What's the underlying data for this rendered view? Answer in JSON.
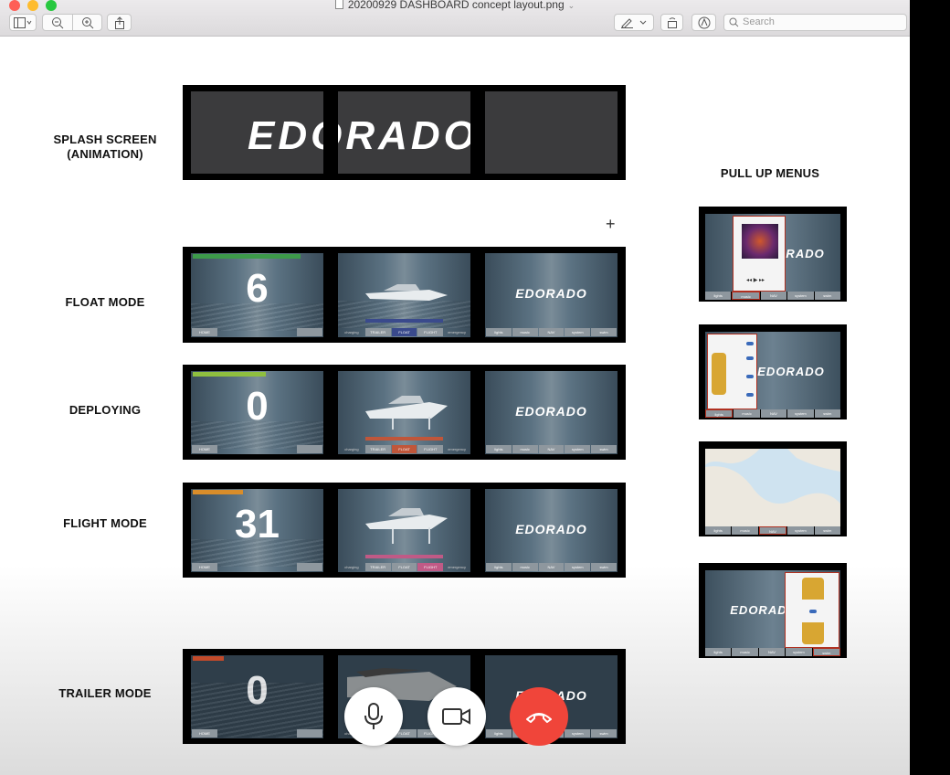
{
  "window": {
    "title": "20200929 DASHBOARD concept layout.png"
  },
  "toolbar": {
    "search_placeholder": "Search"
  },
  "labels": {
    "splash": "SPLASH SCREEN",
    "splash_sub": "(ANIMATION)",
    "float": "FLOAT MODE",
    "deploying": "DEPLOYING",
    "flight": "FLIGHT MODE",
    "trailer": "TRAILER MODE",
    "pull": "PULL UP MENUS"
  },
  "splash": {
    "text": "EDORADO"
  },
  "brand": "EDORADO",
  "rows": {
    "float": {
      "number": "6"
    },
    "deploying": {
      "number": "0"
    },
    "flight": {
      "number": "31"
    },
    "trailer": {
      "number": "0"
    }
  },
  "nav": {
    "lights": "lights",
    "music": "music",
    "nav": "NAV",
    "system": "system",
    "swim": "swim"
  },
  "modes": {
    "trailer": "TRAILER",
    "float": "FLOAT",
    "flight": "FLIGHT",
    "charging": "charging",
    "emergency": "emergency"
  },
  "home": "HOME",
  "colors": {
    "close": "#d9534f",
    "accent_float": "#3a4a8c",
    "accent_deploy": "#c0563a",
    "accent_flight": "#c05a86"
  }
}
